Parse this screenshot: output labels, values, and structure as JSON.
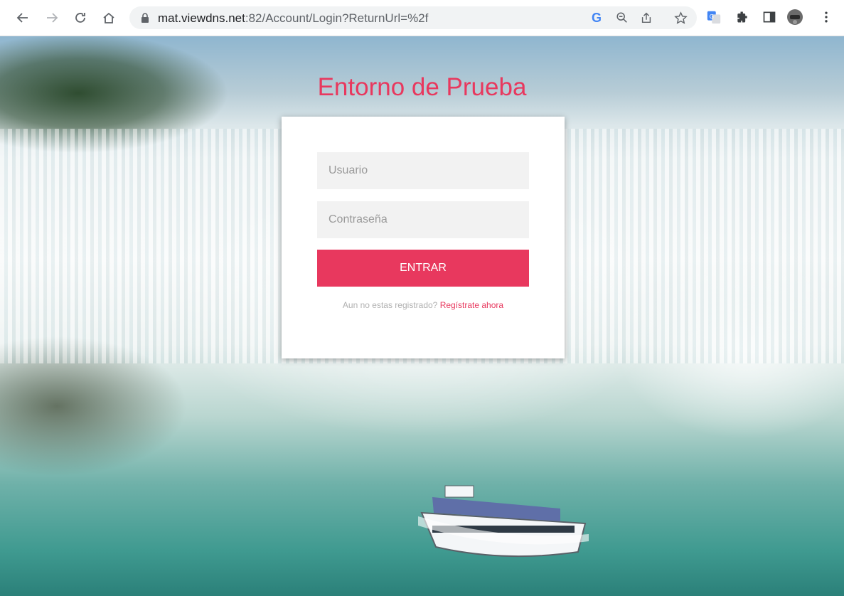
{
  "browser": {
    "url_host": "mat.viewdns.net",
    "url_rest": ":82/Account/Login?ReturnUrl=%2f",
    "icons": [
      "back-icon",
      "forward-icon",
      "reload-icon",
      "home-icon",
      "lock-icon",
      "google-icon",
      "zoom-icon",
      "share-icon",
      "star-icon",
      "translate-icon",
      "extensions-icon",
      "sidepanel-icon",
      "profile-icon",
      "menu-icon"
    ],
    "google_letter": "G"
  },
  "login": {
    "title": "Entorno de Prueba",
    "user_placeholder": "Usuario",
    "password_placeholder": "Contraseña",
    "submit_label": "ENTRAR",
    "register_prompt": "Aun no estas registrado?",
    "register_link": "Regístrate ahora"
  },
  "colors": {
    "accent": "#e8385e"
  }
}
